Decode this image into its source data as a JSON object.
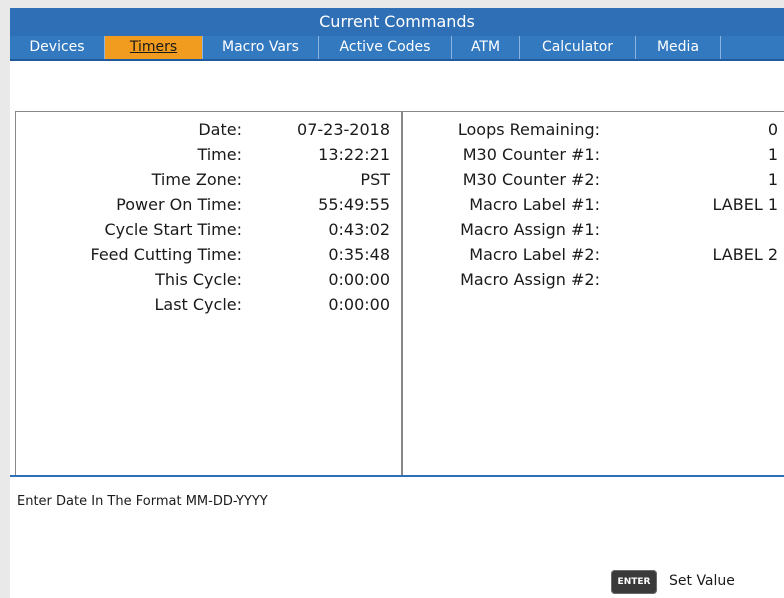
{
  "window": {
    "title": "Current Commands"
  },
  "tabs": [
    "Devices",
    "Timers",
    "Macro Vars",
    "Active Codes",
    "ATM",
    "Calculator",
    "Media"
  ],
  "active_tab": "Timers",
  "left_panel": {
    "rows": [
      {
        "label": "Date:",
        "value": "07-23-2018"
      },
      {
        "label": "Time:",
        "value": "13:22:21"
      },
      {
        "label": "Time Zone:",
        "value": "PST"
      },
      {
        "label": "Power On Time:",
        "value": "55:49:55"
      },
      {
        "label": "Cycle Start Time:",
        "value": "0:43:02"
      },
      {
        "label": "Feed Cutting Time:",
        "value": "0:35:48"
      },
      {
        "label": "This Cycle:",
        "value": "0:00:00"
      },
      {
        "label": "Last Cycle:",
        "value": "0:00:00"
      }
    ]
  },
  "right_panel": {
    "rows": [
      {
        "label": "Loops Remaining:",
        "value": "0"
      },
      {
        "label": "M30 Counter #1:",
        "value": "1"
      },
      {
        "label": "M30 Counter #2:",
        "value": "1"
      },
      {
        "label": "Macro Label #1:",
        "value": "LABEL 1"
      },
      {
        "label": "Macro Assign #1:",
        "value": ""
      },
      {
        "label": "Macro Label #2:",
        "value": "LABEL 2"
      },
      {
        "label": "Macro Assign #2:",
        "value": ""
      }
    ]
  },
  "prompt": "Enter Date In The Format MM-DD-YYYY",
  "actions": {
    "enter_key": "ENTER",
    "enter_label": "Set Value"
  },
  "colors": {
    "title_bar": "#2e6fb5",
    "tab_bar": "#3279c0",
    "active_tab": "#f29c1f"
  }
}
